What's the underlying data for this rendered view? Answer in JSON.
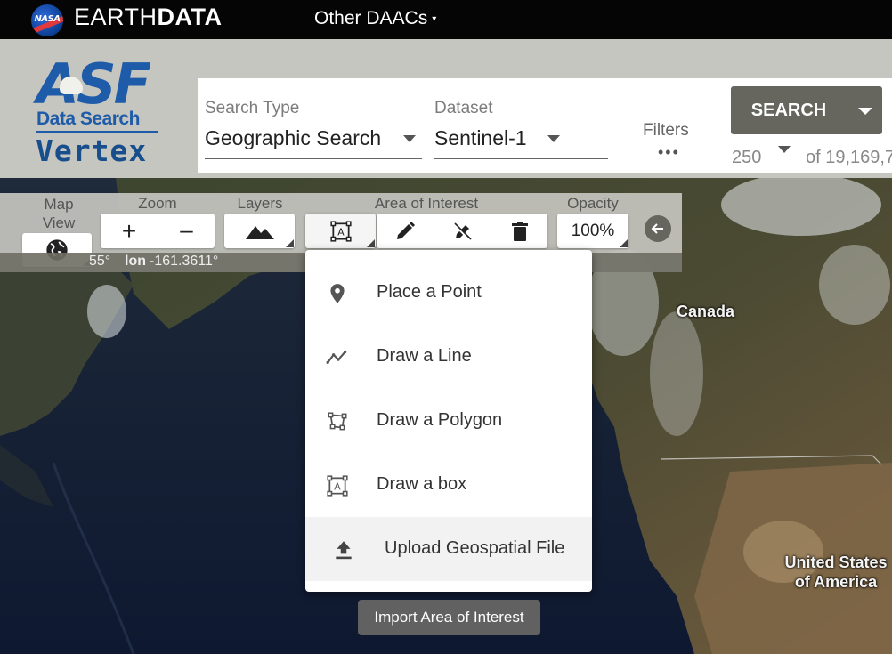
{
  "topbar": {
    "nasa_logo": "NASA",
    "brand_light": "EARTH",
    "brand_bold": "DATA",
    "daacs_menu": "Other DAACs",
    "daacs_caret": "▾"
  },
  "logo": {
    "letters": "ASF",
    "line1": "Data Search",
    "line2": "Vertex"
  },
  "search": {
    "type_label": "Search Type",
    "type_value": "Geographic Search",
    "dataset_label": "Dataset",
    "dataset_value": "Sentinel-1",
    "filters_label": "Filters",
    "filters_dots": "•••",
    "search_button": "SEARCH",
    "max_results": "250",
    "total_results": "of 19,169,7"
  },
  "toolbar": {
    "map_view_label": "Map View",
    "zoom_label": "Zoom",
    "layers_label": "Layers",
    "aoi_label": "Area of Interest",
    "opacity_label": "Opacity",
    "opacity_value": "100%",
    "zoom_in": "+",
    "zoom_out": "–",
    "latitude_fragment": "55°",
    "longitude_label": "lon",
    "longitude_value": "-161.3611°"
  },
  "aoi_menu": {
    "items": [
      {
        "label": "Place a Point",
        "icon": "place-pin-icon"
      },
      {
        "label": "Draw a Line",
        "icon": "line-icon"
      },
      {
        "label": "Draw a Polygon",
        "icon": "polygon-icon"
      },
      {
        "label": "Draw a box",
        "icon": "box-icon"
      },
      {
        "label": "Upload Geospatial File",
        "icon": "upload-icon"
      }
    ]
  },
  "tooltip": "Import Area of Interest",
  "map_labels": {
    "canada": "Canada",
    "usa": "United States of America"
  },
  "colors": {
    "asf_blue": "#1e5ba8",
    "header_bg": "#c6c6c0",
    "search_button_bg": "#66665f",
    "tooltip_bg": "#616161"
  }
}
